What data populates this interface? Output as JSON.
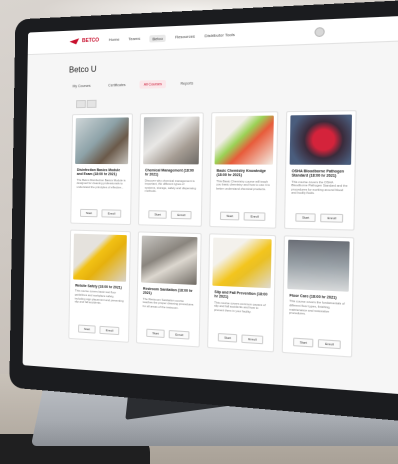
{
  "site": {
    "logo_text": "BETCO",
    "nav": [
      "Home",
      "Teams",
      "Betco",
      "Resources",
      "Distributor Tools"
    ],
    "nav_active_index": 2
  },
  "page": {
    "title": "Betco U",
    "tabs": [
      "My Courses",
      "Certificates",
      "All Courses",
      "Reports"
    ],
    "active_tab_index": 2
  },
  "cards": [
    {
      "title": "Disinfection Basics Module and Exam (18:00 hr 2021)",
      "desc": "The Betco Disinfection Basics Module is designed for cleaning professionals to understand the principles of effective...",
      "image": "lab"
    },
    {
      "title": "Chemical Management (18:00 hr 2021)",
      "desc": "Discover why chemical management is important, the different types of systems, storage, safety and dispensing methods.",
      "image": "chemical"
    },
    {
      "title": "Basic Chemistry Knowledge (18:00 hr 2021)",
      "desc": "This Basic Chemistry course will teach you basic chemistry and how to use it to better understand chemical products.",
      "image": "glove"
    },
    {
      "title": "OSHA Bloodborne Pathogen Standard (18:00 hr 2021)",
      "desc": "This course covers the OSHA Bloodborne Pathogen Standard and the procedures for working around blood and bodily fluids.",
      "image": "red"
    },
    {
      "title": "Wetsite Safety (18:00 hr 2021)",
      "desc": "This course covers basic wet floor guidelines and workplace safety, including sign placement and preventing slip and fall accidents.",
      "image": "sign1"
    },
    {
      "title": "Restroom Sanitation (18:00 hr 2021)",
      "desc": "The Restroom Sanitation course teaches the proper cleaning procedures for all areas of the restroom.",
      "image": "sink"
    },
    {
      "title": "Slip and Fall Prevention (18:00 hr 2021)",
      "desc": "This course covers common causes of slip and fall accidents and how to prevent them in your facility.",
      "image": "sign2"
    },
    {
      "title": "Floor Care (18:00 hr 2021)",
      "desc": "This course covers the fundamentals of different floor types, finishing, maintenance and restorative procedures.",
      "image": "floor"
    }
  ],
  "card_actions": {
    "start": "Start",
    "enroll": "Enroll"
  }
}
